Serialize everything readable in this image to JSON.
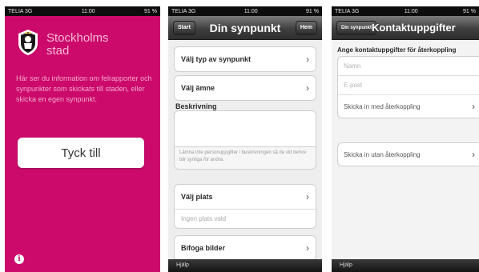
{
  "status": {
    "carrier": "TELIA 3G",
    "time": "11:00",
    "battery": "91 %"
  },
  "screen1": {
    "brand_line1": "Stockholms",
    "brand_line2": "stad",
    "intro_text": "Här ser du information om felrapporter och synpunkter som skickats till staden, eller skicka en egen synpunkt.",
    "button_label": "Tyck till",
    "info_icon": "i"
  },
  "screen2": {
    "title": "Din synpunkt",
    "left_button": "Start",
    "right_button": "Hem",
    "rows": {
      "type": "Välj typ av synpunkt",
      "subject": "Välj ämne",
      "place": "Välj plats",
      "attach": "Bifoga bilder"
    },
    "description_label": "Beskrivning",
    "description_hint": "Lämna inte personuppgifter i beskrivningen så de vid behov blir synliga för andra.",
    "no_place": "Ingen plats vald",
    "bottom_label": "Hjälp",
    "chevron": "›"
  },
  "screen3": {
    "title": "Kontaktuppgifter",
    "back_button": "Din synpunkt",
    "heading": "Ange kontaktuppgifter för återkoppling",
    "name_placeholder": "Namn",
    "email_placeholder": "E-post",
    "send_with": "Skicka in med återkoppling",
    "send_without": "Skicka in utan återkoppling",
    "bottom_label": "Hjälp",
    "chevron": "›"
  },
  "colors": {
    "accent": "#cc0a6b",
    "navbar": "#3f3f3f"
  }
}
